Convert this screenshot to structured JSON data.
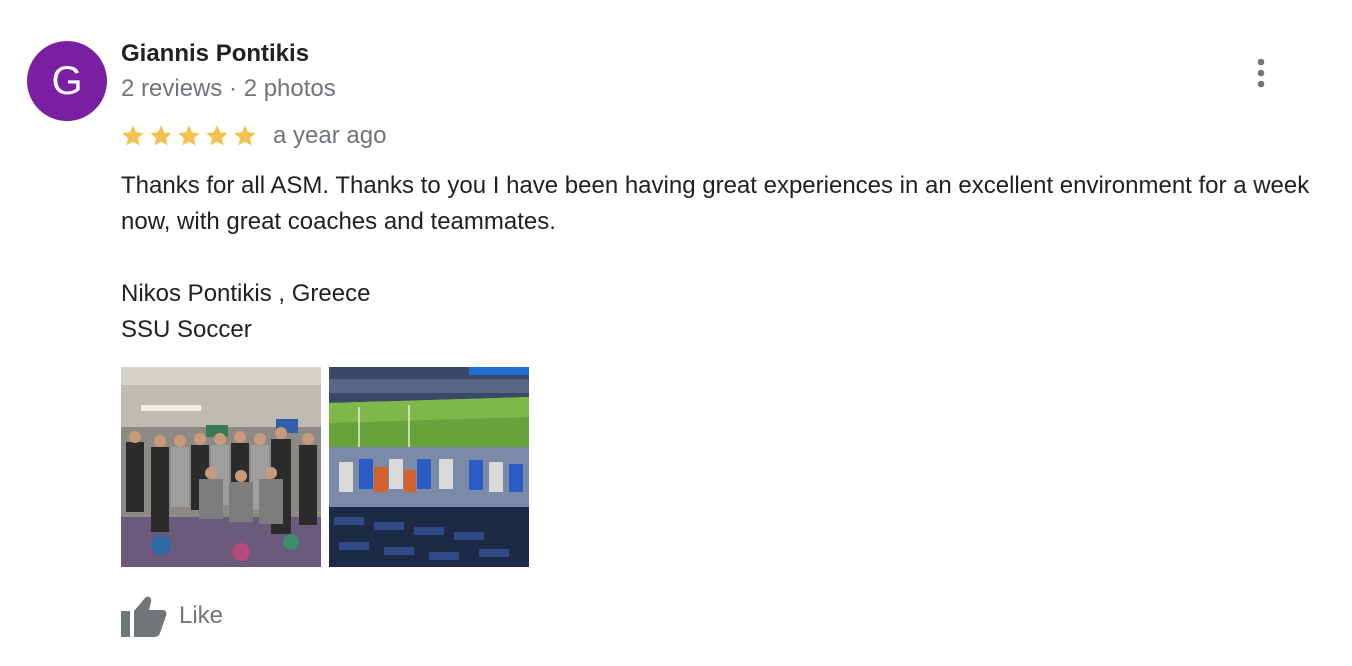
{
  "reviewer": {
    "avatar_letter": "G",
    "avatar_color": "#7b1fa2",
    "name": "Giannis Pontikis",
    "meta": "2 reviews · 2 photos"
  },
  "rating": {
    "stars": 5,
    "max_stars": 5,
    "star_color": "#f4c04e",
    "date": "a year ago"
  },
  "review": {
    "paragraph1": "Thanks for all ASM. Thanks to you I have been having great experiences in an excellent environment for a week now, with great coaches and teammates.",
    "signature_line1": "Nikos Pontikis , Greece",
    "signature_line2": "SSU Soccer"
  },
  "photos": [
    {
      "name": "team-photo-indoor"
    },
    {
      "name": "team-photo-stadium"
    }
  ],
  "actions": {
    "like_label": "Like",
    "more_icon": "more-vert-icon",
    "like_icon": "thumb-up-icon"
  }
}
